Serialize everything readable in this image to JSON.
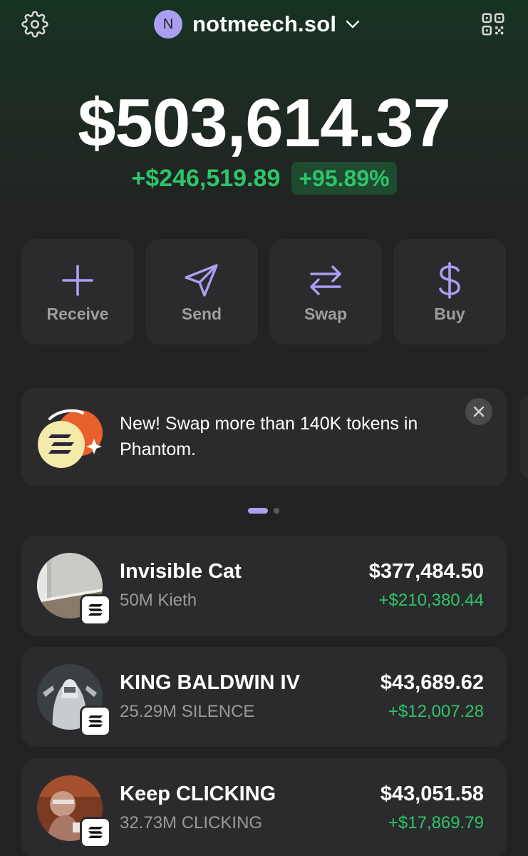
{
  "header": {
    "account_initial": "N",
    "account_name": "notmeech.sol"
  },
  "portfolio": {
    "balance": "$503,614.37",
    "change_amount": "+$246,519.89",
    "change_percent": "+95.89%"
  },
  "actions": [
    {
      "label": "Receive",
      "icon": "plus-icon"
    },
    {
      "label": "Send",
      "icon": "send-icon"
    },
    {
      "label": "Swap",
      "icon": "swap-icon"
    },
    {
      "label": "Buy",
      "icon": "dollar-icon"
    }
  ],
  "promo": {
    "text": "New! Swap more than 140K tokens in Phantom.",
    "pages": 2,
    "active_page": 1
  },
  "tokens": [
    {
      "name": "Invisible Cat",
      "amount": "50M Kieth",
      "value": "$377,484.50",
      "change": "+$210,380.44"
    },
    {
      "name": "KING BALDWIN IV",
      "amount": "25.29M SILENCE",
      "value": "$43,689.62",
      "change": "+$12,007.28"
    },
    {
      "name": "Keep CLICKING",
      "amount": "32.73M CLICKING",
      "value": "$43,051.58",
      "change": "+$17,869.79"
    }
  ],
  "colors": {
    "accent": "#ab9ff2",
    "positive": "#2ec46a",
    "card": "#2b2b2d",
    "background": "#222222"
  }
}
